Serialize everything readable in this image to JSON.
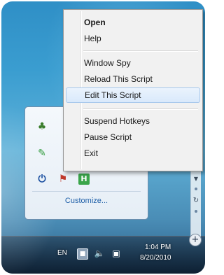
{
  "context_menu": {
    "items": [
      {
        "label": "Open",
        "bold": true
      },
      {
        "label": "Help"
      },
      {
        "label": "Window Spy"
      },
      {
        "label": "Reload This Script"
      },
      {
        "label": "Edit This Script",
        "highlighted": true
      },
      {
        "label": "Suspend Hotkeys"
      },
      {
        "label": "Pause Script"
      },
      {
        "label": "Exit"
      }
    ]
  },
  "tray_flyout": {
    "icons": [
      {
        "name": "autohotkey-tray-icon"
      },
      {
        "name": "green-script-icon"
      },
      {
        "name": "power-icon"
      },
      {
        "name": "user-accounts-icon"
      },
      {
        "name": "green-h-icon"
      }
    ],
    "customize_label": "Customize..."
  },
  "taskbar": {
    "language": "EN",
    "time": "1:04 PM",
    "date": "8/20/2010"
  },
  "colors": {
    "highlight": "#d9e9fb",
    "link": "#1f5fa8",
    "desktop": "#3a9dd0"
  }
}
